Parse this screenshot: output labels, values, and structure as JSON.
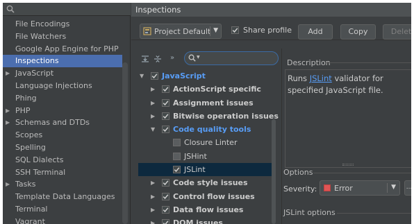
{
  "sidebar": {
    "items": [
      {
        "label": "File Encodings",
        "arrow": false,
        "selected": false
      },
      {
        "label": "File Watchers",
        "arrow": false,
        "selected": false
      },
      {
        "label": "Google App Engine for PHP",
        "arrow": false,
        "selected": false
      },
      {
        "label": "Inspections",
        "arrow": false,
        "selected": true
      },
      {
        "label": "JavaScript",
        "arrow": true,
        "selected": false
      },
      {
        "label": "Language Injections",
        "arrow": false,
        "selected": false
      },
      {
        "label": "Phing",
        "arrow": false,
        "selected": false
      },
      {
        "label": "PHP",
        "arrow": true,
        "selected": false
      },
      {
        "label": "Schemas and DTDs",
        "arrow": true,
        "selected": false
      },
      {
        "label": "Scopes",
        "arrow": false,
        "selected": false
      },
      {
        "label": "Spelling",
        "arrow": false,
        "selected": false
      },
      {
        "label": "SQL Dialects",
        "arrow": false,
        "selected": false
      },
      {
        "label": "SSH Terminal",
        "arrow": false,
        "selected": false
      },
      {
        "label": "Tasks",
        "arrow": true,
        "selected": false
      },
      {
        "label": "Template Data Languages",
        "arrow": false,
        "selected": false
      },
      {
        "label": "Terminal",
        "arrow": false,
        "selected": false
      },
      {
        "label": "Vagrant",
        "arrow": false,
        "selected": false
      }
    ]
  },
  "header": {
    "title": "Inspections"
  },
  "toolbar": {
    "profile": "Project Default",
    "share_label": "Share profile",
    "share_checked": true,
    "add_label": "Add",
    "copy_label": "Copy",
    "delete_label": "Delete"
  },
  "tree": {
    "rows": [
      {
        "label": "JavaScript",
        "level": 0,
        "expanded": true,
        "checked": true,
        "bold": true,
        "blue": true,
        "selected": false
      },
      {
        "label": "ActionScript specific",
        "level": 1,
        "expanded": false,
        "checked": true,
        "bold": true,
        "blue": false,
        "selected": false
      },
      {
        "label": "Assignment issues",
        "level": 1,
        "expanded": false,
        "checked": true,
        "bold": true,
        "blue": false,
        "selected": false
      },
      {
        "label": "Bitwise operation issues",
        "level": 1,
        "expanded": false,
        "checked": true,
        "bold": true,
        "blue": false,
        "selected": false
      },
      {
        "label": "Code quality tools",
        "level": 1,
        "expanded": true,
        "checked": true,
        "bold": true,
        "blue": true,
        "selected": false
      },
      {
        "label": "Closure Linter",
        "level": 2,
        "expanded": null,
        "checked": false,
        "bold": false,
        "blue": false,
        "selected": false
      },
      {
        "label": "JSHint",
        "level": 2,
        "expanded": null,
        "checked": false,
        "bold": false,
        "blue": false,
        "selected": false
      },
      {
        "label": "JSLint",
        "level": 2,
        "expanded": null,
        "checked": true,
        "bold": false,
        "blue": false,
        "selected": true
      },
      {
        "label": "Code style issues",
        "level": 1,
        "expanded": false,
        "checked": true,
        "bold": true,
        "blue": false,
        "selected": false
      },
      {
        "label": "Control flow issues",
        "level": 1,
        "expanded": false,
        "checked": true,
        "bold": true,
        "blue": false,
        "selected": false
      },
      {
        "label": "Data flow issues",
        "level": 1,
        "expanded": false,
        "checked": true,
        "bold": true,
        "blue": false,
        "selected": false
      },
      {
        "label": "DOM issues",
        "level": 1,
        "expanded": false,
        "checked": true,
        "bold": true,
        "blue": false,
        "selected": false
      }
    ]
  },
  "description": {
    "title": "Description",
    "text_before": "Runs ",
    "link": "JSLint",
    "text_after": " validator for specified JavaScript file."
  },
  "options": {
    "title": "Options",
    "severity_label": "Severity:",
    "severity_value": "Error",
    "more_label": "...",
    "jslint_options_title": "JSLint options"
  },
  "colors": {
    "selection": "#4b6eaf",
    "tree_selection": "#0d293e",
    "link": "#589df6",
    "error": "#e05555"
  }
}
